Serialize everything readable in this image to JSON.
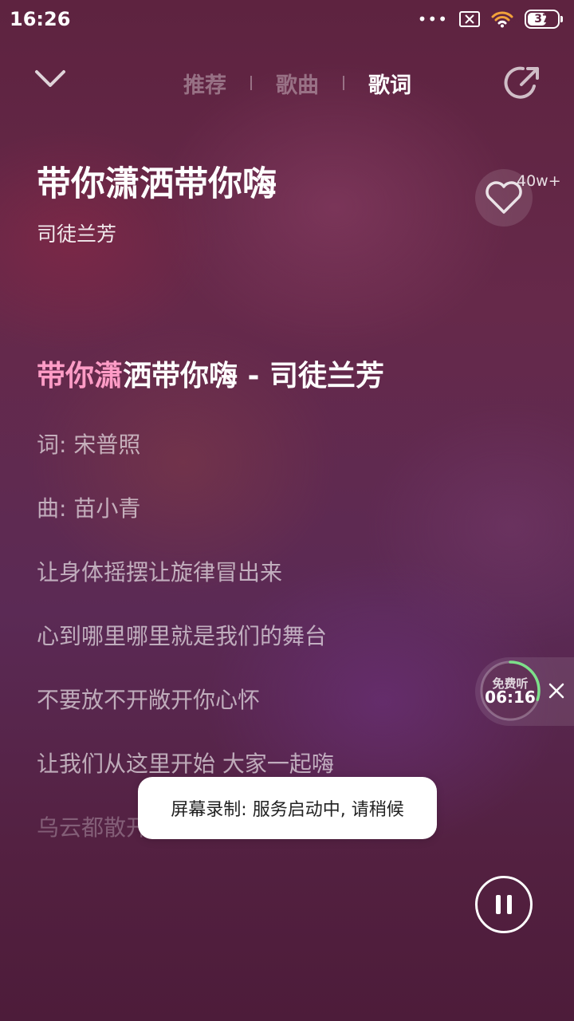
{
  "status_bar": {
    "time": "16:26",
    "battery": "37",
    "icons": [
      "more-dots-icon",
      "sim-off-icon",
      "wifi-icon",
      "battery-icon"
    ]
  },
  "nav": {
    "tabs": [
      {
        "label": "推荐",
        "active": false
      },
      {
        "label": "歌曲",
        "active": false
      },
      {
        "label": "歌词",
        "active": true
      }
    ]
  },
  "song": {
    "title": "带你潇洒带你嗨",
    "artist": "司徒兰芳",
    "like_count": "40w+"
  },
  "lyrics": {
    "current_highlight": "带你潇",
    "current_rest": "洒带你嗨 - 司徒兰芳",
    "lines": [
      "词: 宋普照",
      "曲: 苗小青",
      "让身体摇摆让旋律冒出来",
      "心到哪里哪里就是我们的舞台",
      "不要放不开敞开你心怀",
      "让我们从这里开始 大家一起嗨",
      "乌云都散开"
    ]
  },
  "free_listen": {
    "label": "免费听",
    "time": "06:16",
    "progress": 0.3
  },
  "toast": {
    "message": "屏幕录制: 服务启动中, 请稍候"
  },
  "colors": {
    "accent_pink": "#ff9cc6",
    "progress_green": "#7de08a"
  }
}
